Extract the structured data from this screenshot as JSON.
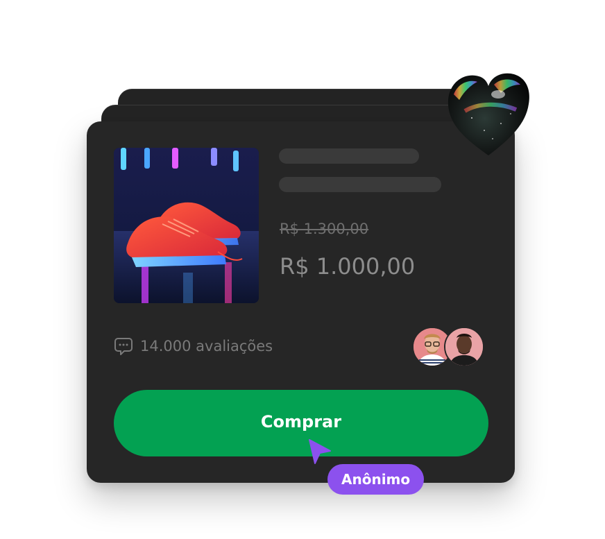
{
  "product": {
    "image_alt": "red running sneakers under neon lights",
    "old_price": "R$ 1.300,00",
    "price": "R$ 1.000,00"
  },
  "reviews": {
    "icon": "chat-bubble-icon",
    "text": "14.000 avaliações"
  },
  "avatars": [
    {
      "name": "reviewer-avatar-1"
    },
    {
      "name": "reviewer-avatar-2"
    }
  ],
  "actions": {
    "buy_label": "Comprar"
  },
  "cursor": {
    "user_label": "Anônimo"
  },
  "colors": {
    "card": "#262626",
    "skeleton": "#3a3a3a",
    "buy_button": "#03a152",
    "user_tag": "#8c51ee"
  }
}
